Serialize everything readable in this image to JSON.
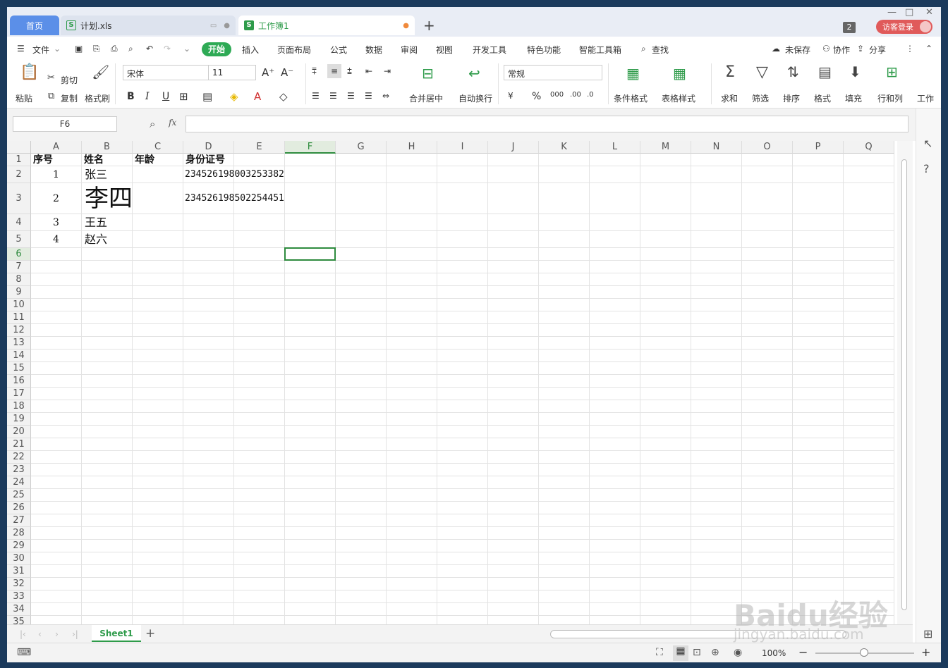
{
  "tabs": {
    "home": "首页",
    "plan": "计划.xls",
    "book": "工作簿1",
    "add": "+"
  },
  "titlebar": {
    "badge": "2",
    "login": "访客登录",
    "minimize": "—",
    "maximize": "□",
    "close": "✕"
  },
  "menu": {
    "file": "文件",
    "start": "开始",
    "insert": "插入",
    "layout": "页面布局",
    "formula": "公式",
    "data": "数据",
    "review": "审阅",
    "view": "视图",
    "dev": "开发工具",
    "special": "特色功能",
    "smart": "智能工具箱",
    "find": "查找",
    "unsaved": "未保存",
    "collab": "协作",
    "share": "分享"
  },
  "ribbon": {
    "paste": "粘贴",
    "cut": "剪切",
    "copy": "复制",
    "format_painter": "格式刷",
    "font": "宋体",
    "size": "11",
    "bold": "B",
    "italic": "I",
    "underline": "U",
    "merge": "合并居中",
    "wrap": "自动换行",
    "number_format": "常规",
    "cond_format": "条件格式",
    "table_style": "表格样式",
    "sum": "求和",
    "filter": "筛选",
    "sort": "排序",
    "format": "格式",
    "fill": "填充",
    "rowcol": "行和列",
    "worksheet": "工作"
  },
  "formula_bar": {
    "name_box": "F6",
    "fx": "fx",
    "value": ""
  },
  "columns": [
    "A",
    "B",
    "C",
    "D",
    "E",
    "F",
    "G",
    "H",
    "I",
    "J",
    "K",
    "L",
    "M",
    "N",
    "O",
    "P",
    "Q"
  ],
  "selected_cell": "F6",
  "rows": [
    {
      "num": "1",
      "A": "序号",
      "B": "姓名",
      "C": "年龄",
      "D": "身份证号"
    },
    {
      "num": "2",
      "A": "1",
      "B": "张三",
      "C": "",
      "D": "234526198003253382"
    },
    {
      "num": "3",
      "A": "2",
      "B": "李四",
      "C": "",
      "D": "234526198502254451"
    },
    {
      "num": "4",
      "A": "3",
      "B": "王五",
      "C": "",
      "D": ""
    },
    {
      "num": "5",
      "A": "4",
      "B": "赵六",
      "C": "",
      "D": ""
    }
  ],
  "empty_row_numbers": [
    "6",
    "7",
    "8",
    "9",
    "10",
    "11",
    "12",
    "13",
    "14",
    "15",
    "16",
    "17",
    "18",
    "19",
    "20",
    "21",
    "22",
    "23",
    "24",
    "25",
    "26",
    "27",
    "28",
    "29",
    "30",
    "31",
    "32",
    "33",
    "34",
    "35"
  ],
  "sheet": {
    "name": "Sheet1",
    "add": "+"
  },
  "status": {
    "zoom": "100%",
    "minus": "−",
    "plus": "+"
  },
  "watermark": {
    "brand": "Baidu经验",
    "url": "jingyan.baidu.com"
  },
  "colors": {
    "accent_green": "#2e9b4a",
    "tab_blue": "#5b8fe8",
    "login_red": "#e05a5a"
  }
}
